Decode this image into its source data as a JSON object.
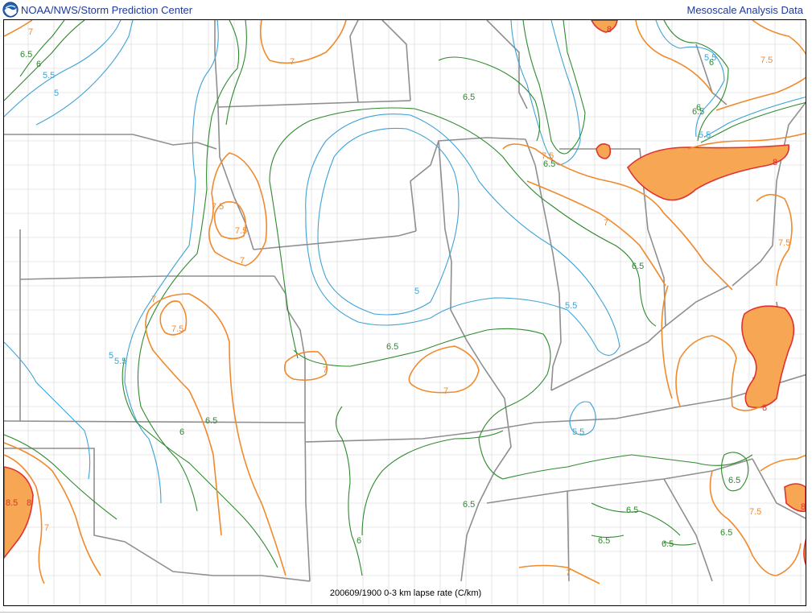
{
  "header": {
    "left_title": "NOAA/NWS/Storm Prediction Center",
    "right_title": "Mesoscale Analysis Data",
    "logo_icon": "noaa-logo-icon"
  },
  "caption": "200609/1900 0-3 km lapse rate (C/km)",
  "colors": {
    "contour_5": "#3ea3d6",
    "contour_6": "#2e8a2e",
    "contour_7": "#f08a2c",
    "contour_8": "#e0322f",
    "fill_8": "#f7a654",
    "county": "#cfcfcf",
    "state": "#8f8f8f"
  },
  "labels": [
    {
      "text": "7",
      "color": "orange"
    },
    {
      "text": "6.5",
      "color": "green"
    },
    {
      "text": "6",
      "color": "green"
    },
    {
      "text": "5.5",
      "color": "blue"
    },
    {
      "text": "5",
      "color": "blue"
    },
    {
      "text": "7",
      "color": "orange"
    },
    {
      "text": "8",
      "color": "red"
    },
    {
      "text": "5.5",
      "color": "blue"
    },
    {
      "text": "6",
      "color": "green"
    },
    {
      "text": "7.5",
      "color": "orange"
    },
    {
      "text": "6.5",
      "color": "green"
    },
    {
      "text": "6",
      "color": "green"
    },
    {
      "text": "5.5",
      "color": "blue"
    },
    {
      "text": "6.5",
      "color": "green"
    },
    {
      "text": "7.5",
      "color": "orange"
    },
    {
      "text": "6.5",
      "color": "green"
    },
    {
      "text": "8",
      "color": "red"
    },
    {
      "text": "7.5",
      "color": "orange"
    },
    {
      "text": "7.5",
      "color": "orange"
    },
    {
      "text": "7",
      "color": "orange"
    },
    {
      "text": "7",
      "color": "orange"
    },
    {
      "text": "6.5",
      "color": "green"
    },
    {
      "text": "7.5",
      "color": "orange"
    },
    {
      "text": "5",
      "color": "blue"
    },
    {
      "text": "5.5",
      "color": "blue"
    },
    {
      "text": "7",
      "color": "orange"
    },
    {
      "text": "7.5",
      "color": "orange"
    },
    {
      "text": "5",
      "color": "blue"
    },
    {
      "text": "5.5",
      "color": "blue"
    },
    {
      "text": "6.5",
      "color": "green"
    },
    {
      "text": "7",
      "color": "orange"
    },
    {
      "text": "7",
      "color": "orange"
    },
    {
      "text": "6.5",
      "color": "green"
    },
    {
      "text": "6",
      "color": "green"
    },
    {
      "text": "5.5",
      "color": "blue"
    },
    {
      "text": "6.5",
      "color": "green"
    },
    {
      "text": "7.5",
      "color": "orange"
    },
    {
      "text": "8",
      "color": "red"
    },
    {
      "text": "8.5",
      "color": "red"
    },
    {
      "text": "8",
      "color": "red"
    },
    {
      "text": "7",
      "color": "orange"
    },
    {
      "text": "6",
      "color": "green"
    },
    {
      "text": "6.5",
      "color": "green"
    },
    {
      "text": "6.5",
      "color": "green"
    },
    {
      "text": "6.5",
      "color": "green"
    },
    {
      "text": "7",
      "color": "orange"
    },
    {
      "text": "6.5",
      "color": "green"
    },
    {
      "text": "8",
      "color": "red"
    },
    {
      "text": "6.5",
      "color": "green"
    }
  ]
}
